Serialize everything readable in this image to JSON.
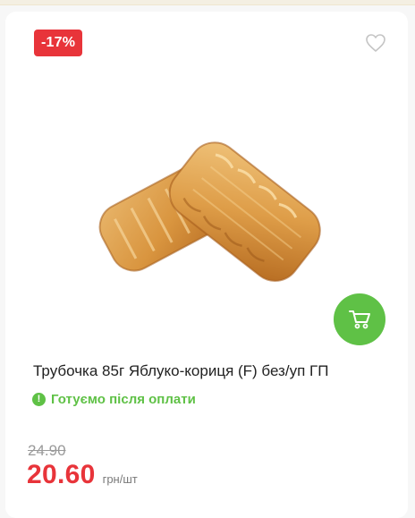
{
  "product": {
    "discount_badge": "-17%",
    "title": "Трубочка 85г Яблуко-кориця (F) без/уп ГП",
    "status_text": "Готуємо після оплати",
    "status_icon_glyph": "!",
    "old_price": "24.90",
    "new_price": "20.60",
    "unit": "грн/шт"
  },
  "icons": {
    "favorite": "heart-outline-icon",
    "cart": "cart-icon",
    "status": "exclamation-circle-icon"
  },
  "colors": {
    "accent_red": "#e8343a",
    "accent_green": "#5fc146"
  }
}
